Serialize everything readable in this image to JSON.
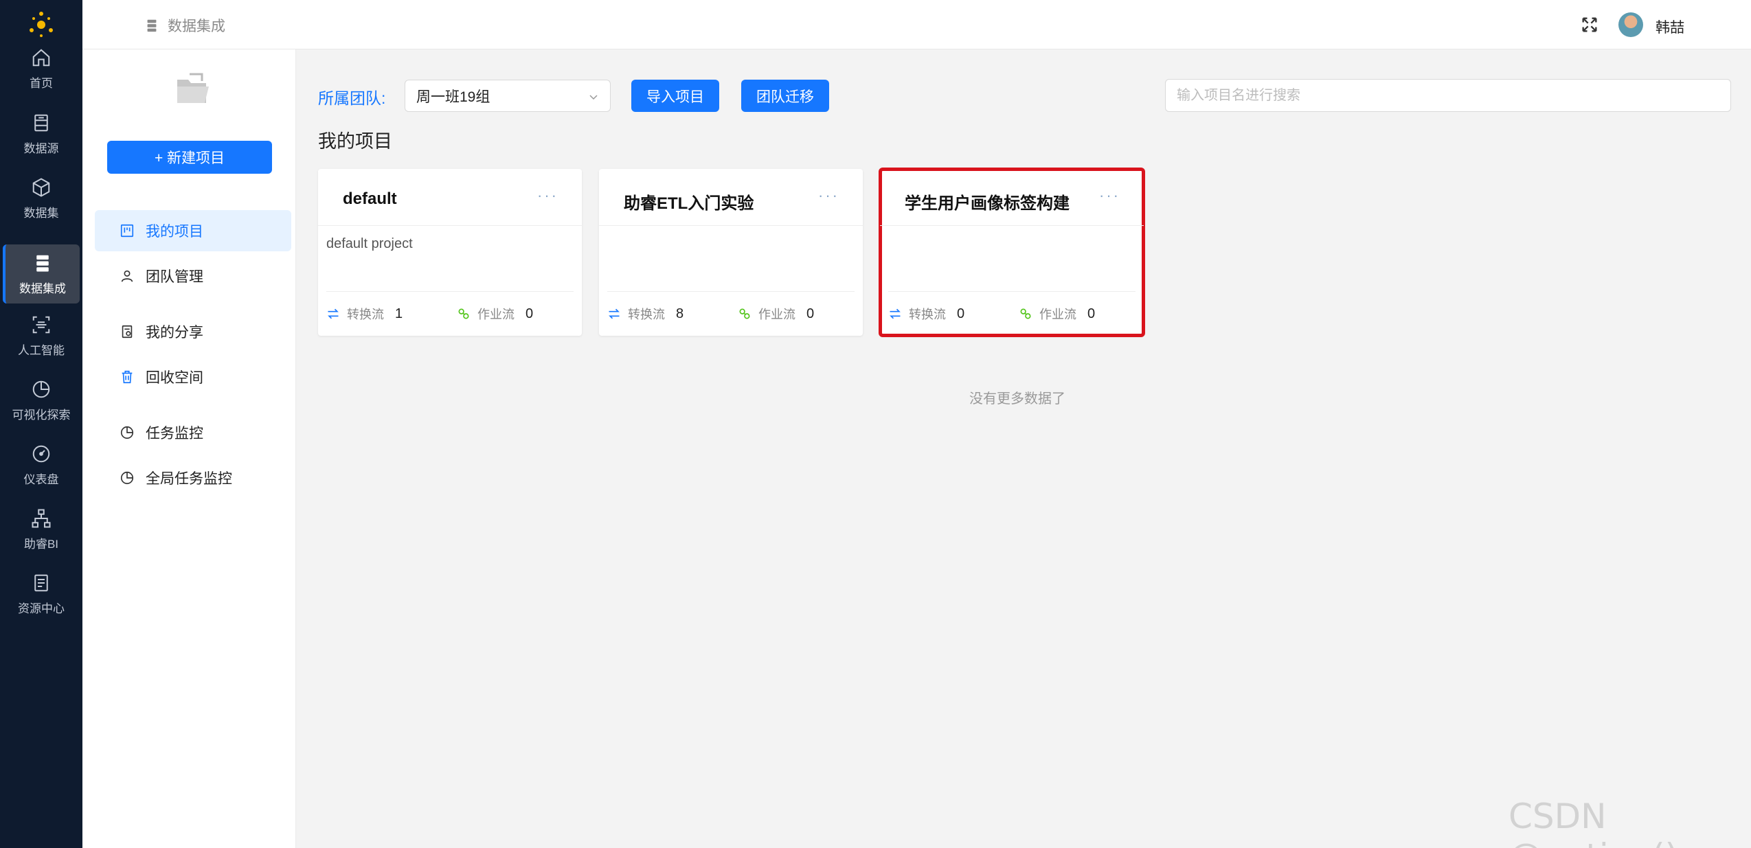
{
  "nav": {
    "items": [
      {
        "label": "首页",
        "icon": "home-icon"
      },
      {
        "label": "数据源",
        "icon": "database-icon"
      },
      {
        "label": "数据集",
        "icon": "cube-icon"
      },
      {
        "label": "数据集成",
        "icon": "server-icon",
        "active": true
      },
      {
        "label": "人工智能",
        "icon": "scan-icon"
      },
      {
        "label": "可视化探索",
        "icon": "pie-chart-icon"
      },
      {
        "label": "仪表盘",
        "icon": "dashboard-icon"
      },
      {
        "label": "助睿BI",
        "icon": "hierarchy-icon"
      },
      {
        "label": "资源中心",
        "icon": "document-icon"
      }
    ]
  },
  "header": {
    "breadcrumb": "数据集成",
    "username": "韩喆"
  },
  "sidebar": {
    "new_button": "+ 新建项目",
    "items": [
      {
        "label": "我的项目",
        "icon": "project-icon",
        "active": true
      },
      {
        "label": "团队管理",
        "icon": "user-icon"
      },
      {
        "label": "我的分享",
        "icon": "share-doc-icon"
      },
      {
        "label": "回收空间",
        "icon": "trash-icon"
      },
      {
        "label": "任务监控",
        "icon": "pie-chart-icon"
      },
      {
        "label": "全局任务监控",
        "icon": "pie-chart-icon"
      }
    ]
  },
  "toolbar": {
    "team_label": "所属团队:",
    "team_value": "周一班19组",
    "import_button": "导入项目",
    "migrate_button": "团队迁移",
    "search_placeholder": "输入项目名进行搜索"
  },
  "main": {
    "section_title": "我的项目",
    "more_symbol": "···",
    "transform_label": "转换流",
    "job_label": "作业流",
    "cards": [
      {
        "title": "default",
        "description": "default project",
        "transform_count": "1",
        "job_count": "0"
      },
      {
        "title": "助睿ETL入门实验",
        "description": "",
        "transform_count": "8",
        "job_count": "0"
      },
      {
        "title": "学生用户画像标签构建",
        "description": "",
        "transform_count": "0",
        "job_count": "0",
        "highlighted": true
      }
    ],
    "no_more": "没有更多数据了"
  },
  "watermark": "CSDN @potion()",
  "colors": {
    "nav_bg": "#0e1b2f",
    "accent": "#1677ff",
    "highlight_border": "#d9131c",
    "job_icon_green": "#52c41a"
  }
}
